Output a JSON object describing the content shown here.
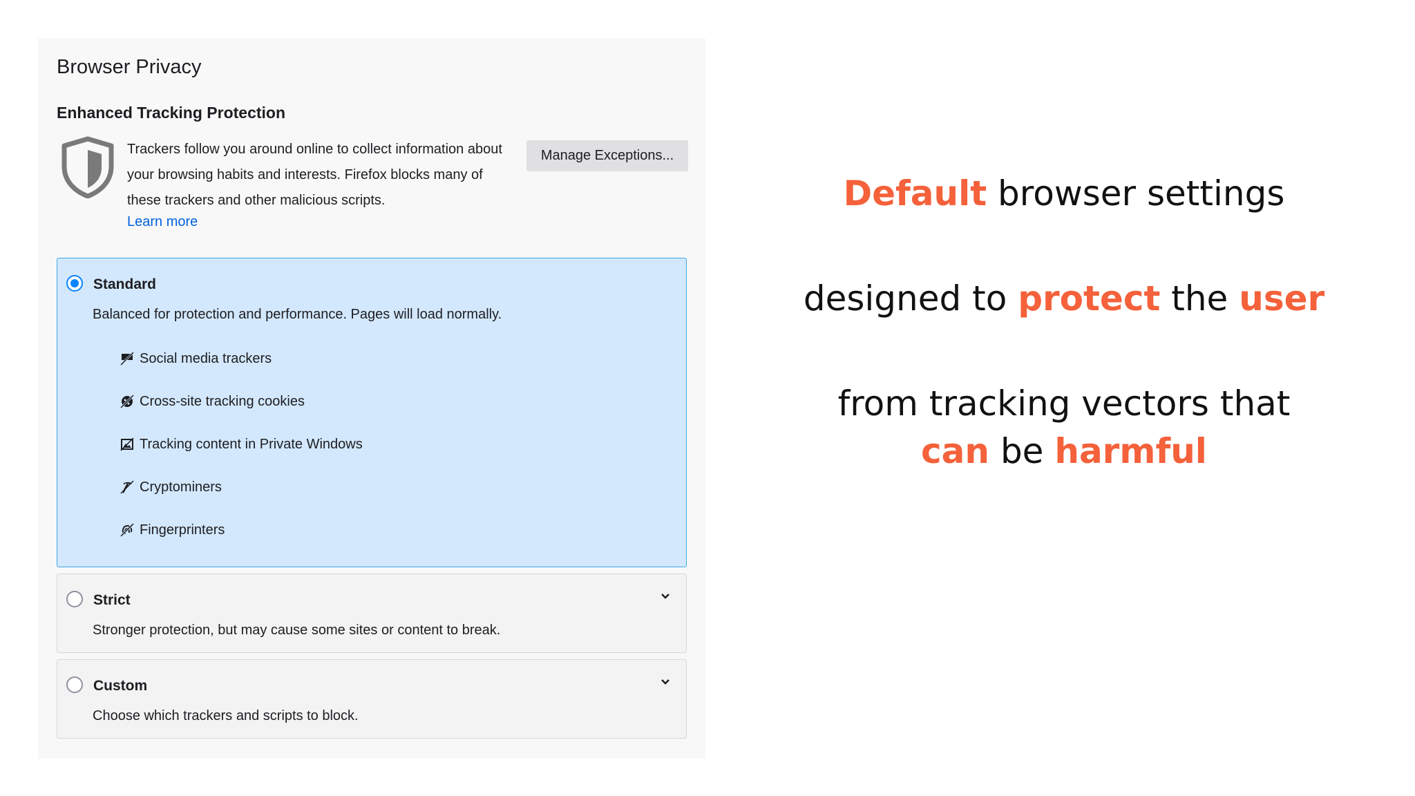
{
  "panel": {
    "title": "Browser Privacy",
    "section_heading": "Enhanced Tracking Protection",
    "description": "Trackers follow you around online to collect information about your browsing habits and interests. Firefox blocks many of these trackers and other malicious scripts.",
    "learn_more": "Learn more",
    "manage_button": "Manage Exceptions..."
  },
  "options": {
    "standard": {
      "label": "Standard",
      "description": "Balanced for protection and performance. Pages will load normally.",
      "selected": true,
      "trackers": [
        {
          "label": "Social media trackers",
          "icon": "social-tracker-icon"
        },
        {
          "label": "Cross-site tracking cookies",
          "icon": "cookie-icon"
        },
        {
          "label": "Tracking content in Private Windows",
          "icon": "tracking-content-icon"
        },
        {
          "label": "Cryptominers",
          "icon": "cryptominer-icon"
        },
        {
          "label": "Fingerprinters",
          "icon": "fingerprint-icon"
        }
      ]
    },
    "strict": {
      "label": "Strict",
      "description": "Stronger protection, but may cause some sites or content to break."
    },
    "custom": {
      "label": "Custom",
      "description": "Choose which trackers and scripts to block."
    }
  },
  "headline": {
    "line1": {
      "w1": "Default",
      "w2": "browser settings"
    },
    "line2": {
      "w1": "designed to",
      "w2": "protect",
      "w3": "the",
      "w4": "user"
    },
    "line3": {
      "text": "from tracking vectors that"
    },
    "line4": {
      "w1": "can",
      "w2": "be",
      "w3": "harmful"
    }
  },
  "colors": {
    "accent": "#f4613a",
    "selected_bg": "#d3e8fc",
    "selected_border": "#3ba9e5",
    "link": "#0060df",
    "radio": "#0a84ff"
  }
}
